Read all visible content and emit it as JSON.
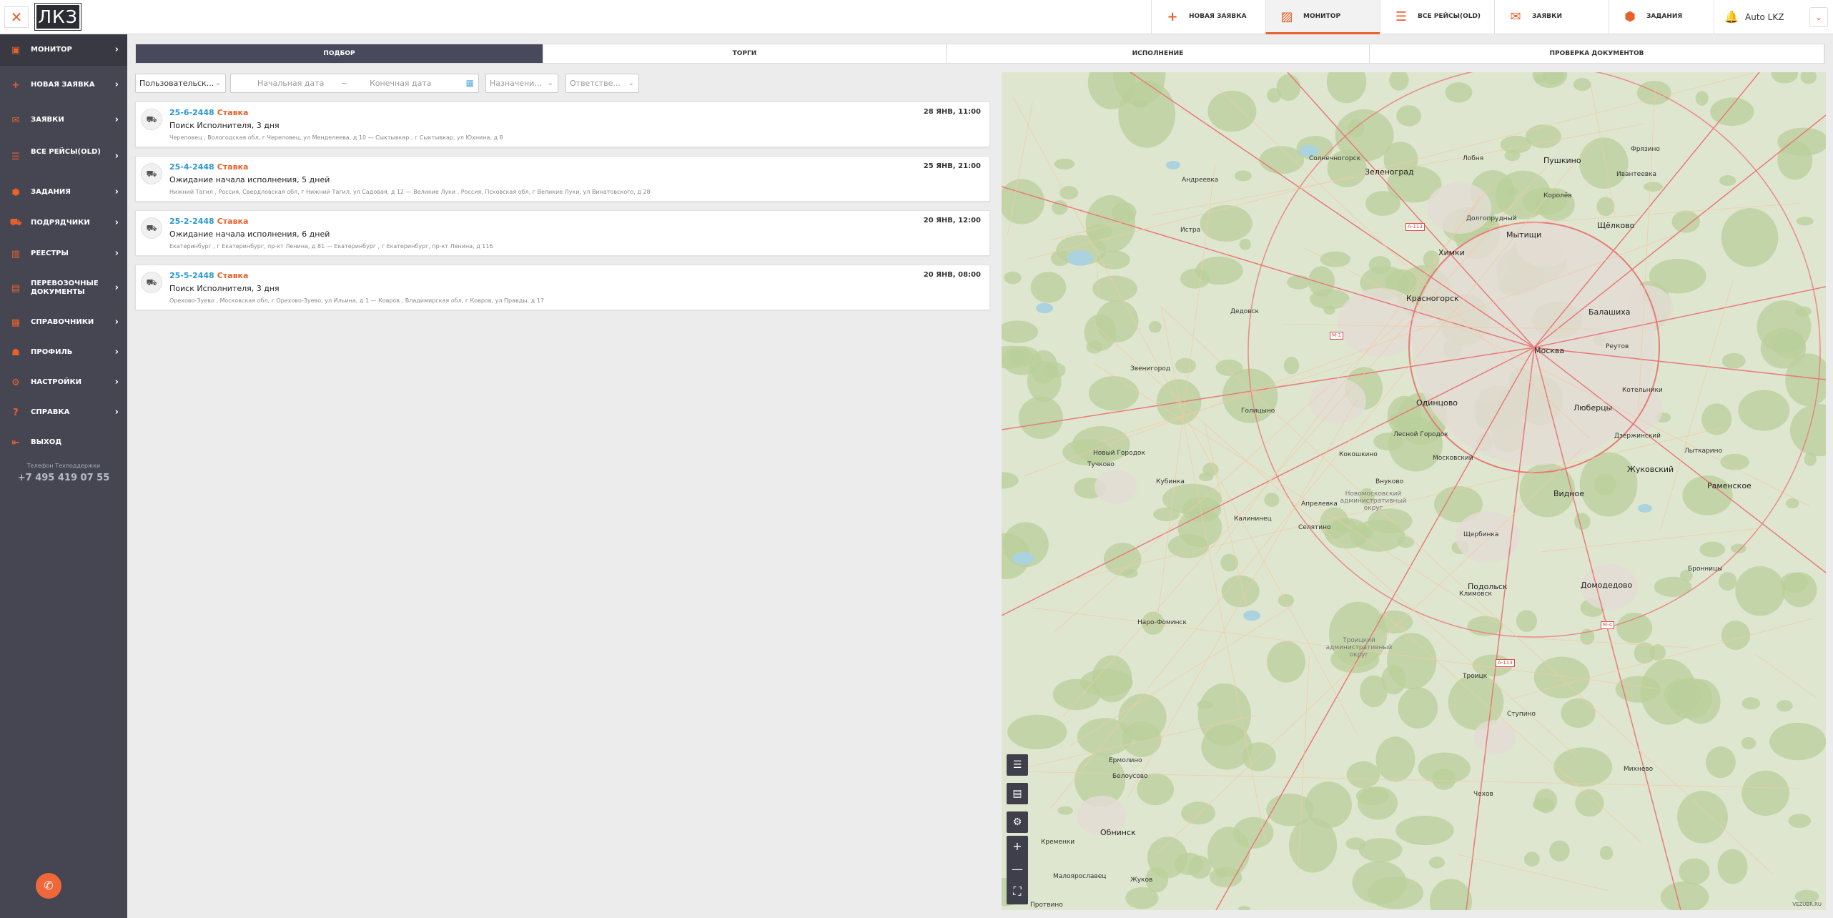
{
  "app": {
    "logo_text": "ЛКЗ",
    "close_glyph": "✕"
  },
  "sidebar": {
    "items": [
      {
        "label": "Монитор",
        "icon": "monitor-icon",
        "glyph": "▣",
        "active": true
      },
      {
        "label": "Новая заявка",
        "icon": "plus-icon",
        "glyph": "+",
        "active": false
      },
      {
        "label": "Заявки",
        "icon": "requests-icon",
        "glyph": "✉",
        "active": false
      },
      {
        "label": "Все рейсы(OLD)",
        "icon": "list-icon",
        "glyph": "☰",
        "active": false
      },
      {
        "label": "Задания",
        "icon": "box-icon",
        "glyph": "⬢",
        "active": false
      },
      {
        "label": "Подрядчики",
        "icon": "truck-icon",
        "glyph": "⛟",
        "active": false
      },
      {
        "label": "Реестры",
        "icon": "registry-icon",
        "glyph": "▥",
        "active": false
      },
      {
        "label": "Перевозочные документы",
        "icon": "documents-icon",
        "glyph": "▤",
        "active": false
      },
      {
        "label": "Справочники",
        "icon": "book-icon",
        "glyph": "▦",
        "active": false
      },
      {
        "label": "Профиль",
        "icon": "profile-icon",
        "glyph": "☗",
        "active": false
      },
      {
        "label": "Настройки",
        "icon": "settings-icon",
        "glyph": "⚙",
        "active": false
      },
      {
        "label": "Справка",
        "icon": "help-icon",
        "glyph": "?",
        "active": false
      },
      {
        "label": "Выход",
        "icon": "logout-icon",
        "glyph": "⇤",
        "active": false
      }
    ],
    "support_label": "Телефон Техподдержки",
    "support_phone": "+7 495 419 07 55",
    "chat_icon": "chat-icon",
    "chevron_glyph": "›"
  },
  "topbar": {
    "tabs": [
      {
        "label": "Новая заявка",
        "icon": "plus-icon",
        "glyph": "+",
        "active": false
      },
      {
        "label": "Монитор",
        "icon": "map-monitor-icon",
        "glyph": "▨",
        "active": true
      },
      {
        "label": "Все рейсы(OLD)",
        "icon": "list-icon",
        "glyph": "☰",
        "active": false
      },
      {
        "label": "Заявки",
        "icon": "requests-icon",
        "glyph": "✉",
        "active": false
      },
      {
        "label": "Задания",
        "icon": "box-icon",
        "glyph": "⬢",
        "active": false
      }
    ],
    "user_name": "Auto LKZ",
    "bell_glyph": "🔔",
    "user_chevron_glyph": "⌄"
  },
  "subtabs": [
    {
      "label": "Подбор",
      "active": true
    },
    {
      "label": "Торги",
      "active": false
    },
    {
      "label": "Исполнение",
      "active": false
    },
    {
      "label": "Проверка документов",
      "active": false
    }
  ],
  "filters": {
    "user_filter": "Пользовательск...",
    "date_start_placeholder": "Начальная дата",
    "date_separator": "~",
    "date_end_placeholder": "Конечная дата",
    "assignment_placeholder": "Назначени...",
    "responsible_placeholder": "Ответстве...",
    "chevron_glyph": "⌄",
    "calendar_glyph": "▦"
  },
  "orders": [
    {
      "id": "25-6-2448",
      "type": "Ставка",
      "date": "28 ЯНВ, 11:00",
      "status": "Поиск Исполнителя, 3 дня",
      "route": "Череповец , Вологодская обл, г Череповец, ул Менделеева, д 10  —  Сыктывкар , г Сыктывкар, ул Юхнина, д 8"
    },
    {
      "id": "25-4-2448",
      "type": "Ставка",
      "date": "25 ЯНВ, 21:00",
      "status": "Ожидание начала исполнения, 5 дней",
      "route": "Нижний Тагил , Россия, Свердловская обл, г Нижний Тагил, ул Садовая, д 12  —  Великие Луки , Россия, Псковская обл, г Великие Луки, ул Винатовского, д 28"
    },
    {
      "id": "25-2-2448",
      "type": "Ставка",
      "date": "20 ЯНВ, 12:00",
      "status": "Ожидание начала исполнения, 6 дней",
      "route": "Екатеринбург , г Екатеринбург, пр-кт Ленина, д 81  —  Екатеринбург , г Екатеринбург, пр-кт Ленина, д 116"
    },
    {
      "id": "25-5-2448",
      "type": "Ставка",
      "date": "20 ЯНВ, 08:00",
      "status": "Поиск Исполнителя, 3 дня",
      "route": "Орехово-Зуево , Московская обл, г Орехово-Зуево, ул Ильина, д 1  —  Ковров , Владимирская обл, г Ковров, ул Правды, д 17"
    }
  ],
  "order_icon_glyph": "⛟",
  "map": {
    "labels": [
      {
        "text": "Москва",
        "kind": "city"
      },
      {
        "text": "Зеленоград",
        "kind": "city"
      },
      {
        "text": "Химки",
        "kind": "city"
      },
      {
        "text": "Мытищи",
        "kind": "city"
      },
      {
        "text": "Пушкино",
        "kind": "city"
      },
      {
        "text": "Щёлково",
        "kind": "city"
      },
      {
        "text": "Балашиха",
        "kind": "city"
      },
      {
        "text": "Реутов",
        "kind": "town"
      },
      {
        "text": "Люберцы",
        "kind": "city"
      },
      {
        "text": "Красногорск",
        "kind": "city"
      },
      {
        "text": "Одинцово",
        "kind": "city"
      },
      {
        "text": "Долгопрудный",
        "kind": "town"
      },
      {
        "text": "Видное",
        "kind": "city"
      },
      {
        "text": "Подольск",
        "kind": "city"
      },
      {
        "text": "Домодедово",
        "kind": "city"
      },
      {
        "text": "Жуковский",
        "kind": "city"
      },
      {
        "text": "Раменское",
        "kind": "city"
      },
      {
        "text": "Обнинск",
        "kind": "city"
      },
      {
        "text": "Наро-Фоминск",
        "kind": "town"
      },
      {
        "text": "Истра",
        "kind": "town"
      },
      {
        "text": "Андреевка",
        "kind": "town"
      },
      {
        "text": "Лобня",
        "kind": "town"
      },
      {
        "text": "Внуково",
        "kind": "town"
      },
      {
        "text": "Московский",
        "kind": "town"
      },
      {
        "text": "Троицк",
        "kind": "town"
      },
      {
        "text": "Апрелевка",
        "kind": "town"
      },
      {
        "text": "Голицыно",
        "kind": "town"
      },
      {
        "text": "Кубинка",
        "kind": "town"
      },
      {
        "text": "Новый Городок",
        "kind": "town"
      },
      {
        "text": "Звенигород",
        "kind": "town"
      },
      {
        "text": "Лесной Городок",
        "kind": "town"
      },
      {
        "text": "Щербинка",
        "kind": "town"
      },
      {
        "text": "Лыткарино",
        "kind": "town"
      },
      {
        "text": "Дзержинский",
        "kind": "town"
      },
      {
        "text": "Котельники",
        "kind": "town"
      },
      {
        "text": "Ступино",
        "kind": "town"
      },
      {
        "text": "Чехов",
        "kind": "town"
      },
      {
        "text": "Климовск",
        "kind": "town"
      },
      {
        "text": "Ермолино",
        "kind": "town"
      },
      {
        "text": "Белоусово",
        "kind": "town"
      },
      {
        "text": "Жуков",
        "kind": "town"
      },
      {
        "text": "Кременки",
        "kind": "town"
      },
      {
        "text": "Малоярославец",
        "kind": "town"
      },
      {
        "text": "Протвино",
        "kind": "town"
      },
      {
        "text": "Михнево",
        "kind": "town"
      },
      {
        "text": "Бронницы",
        "kind": "town"
      },
      {
        "text": "Фрязино",
        "kind": "town"
      },
      {
        "text": "Ивантеевка",
        "kind": "town"
      },
      {
        "text": "Королёв",
        "kind": "town"
      },
      {
        "text": "Солнечногорск",
        "kind": "town"
      },
      {
        "text": "Дедовск",
        "kind": "town"
      },
      {
        "text": "Тучково",
        "kind": "town"
      },
      {
        "text": "Калининец",
        "kind": "town"
      },
      {
        "text": "Селятино",
        "kind": "town"
      },
      {
        "text": "Кокошкино",
        "kind": "town"
      },
      {
        "text": "Новомосковский административный округ",
        "kind": "district"
      },
      {
        "text": "Троицкий административный округ",
        "kind": "district"
      },
      {
        "text": "М-1",
        "kind": "shield"
      },
      {
        "text": "А-113",
        "kind": "shield"
      },
      {
        "text": "М-4",
        "kind": "shield"
      },
      {
        "text": "А-113",
        "kind": "shield"
      }
    ],
    "controls": [
      {
        "icon": "layers-list-icon",
        "glyph": "☰"
      },
      {
        "icon": "map-panel-icon",
        "glyph": "▤"
      },
      {
        "icon": "map-settings-icon",
        "glyph": "⚙"
      }
    ],
    "zoom_in_glyph": "+",
    "zoom_out_glyph": "—",
    "fullscreen_glyph": "⛶",
    "copyright": "VEZUBR.RU",
    "colors": {
      "land": "#dfe6cf",
      "forest": "#b9cf9b",
      "urban": "#e3dcd4",
      "road_major": "#e87a7a",
      "road_minor": "#f3c9a3",
      "water": "#aad3df"
    }
  }
}
